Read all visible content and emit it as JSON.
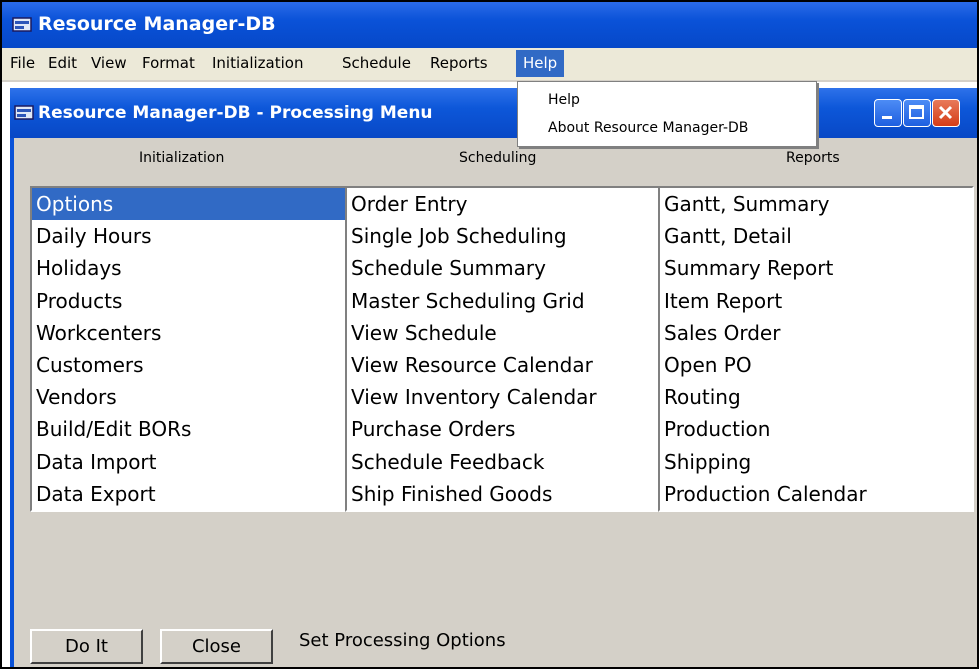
{
  "app": {
    "title": "Resource Manager-DB"
  },
  "menubar": {
    "items": [
      "File",
      "Edit",
      "View",
      "Format",
      "Initialization",
      "Schedule",
      "Reports",
      "Help"
    ],
    "active": "Help"
  },
  "help_menu": {
    "items": [
      "Help",
      "About Resource Manager-DB"
    ]
  },
  "child_window": {
    "title": "Resource Manager-DB - Processing Menu"
  },
  "columns": {
    "initialization": {
      "header": "Initialization",
      "items": [
        "Options",
        "Daily Hours",
        "Holidays",
        "Products",
        "Workcenters",
        "Customers",
        "Vendors",
        "Build/Edit BORs",
        "Data Import",
        "Data Export"
      ],
      "selected": "Options"
    },
    "scheduling": {
      "header": "Scheduling",
      "items": [
        "Order Entry",
        "Single Job Scheduling",
        "Schedule Summary",
        "Master Scheduling Grid",
        "View Schedule",
        "View Resource Calendar",
        "View Inventory Calendar",
        "Purchase Orders",
        "Schedule Feedback",
        "Ship Finished Goods"
      ]
    },
    "reports": {
      "header": "Reports",
      "items": [
        "Gantt, Summary",
        "Gantt, Detail",
        "Summary Report",
        "Item Report",
        "Sales Order",
        "Open PO",
        "Routing",
        "Production",
        "Shipping",
        "Production Calendar"
      ]
    }
  },
  "buttons": {
    "do_it": "Do It",
    "close": "Close"
  },
  "status": {
    "text": "Set Processing Options"
  },
  "icons": [
    "app-icon",
    "minimize-icon",
    "maximize-icon",
    "close-icon"
  ],
  "colors": {
    "titlebar": "#0a52d8",
    "selection": "#316ac5",
    "face": "#d4d0c8",
    "close": "#d43c18"
  }
}
